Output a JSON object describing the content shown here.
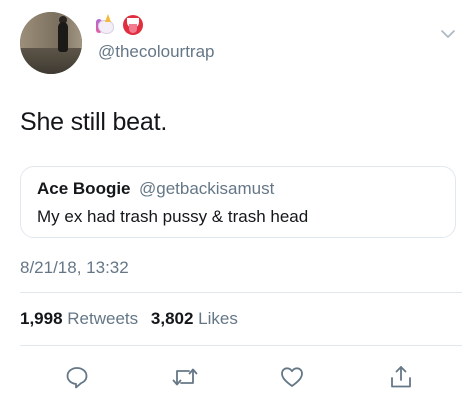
{
  "author": {
    "handle": "@thecolourtrap",
    "emoji_icons": [
      "unicorn-icon",
      "tongue-emoji-icon"
    ]
  },
  "tweet": {
    "text": "She still beat.",
    "timestamp": "8/21/18, 13:32"
  },
  "quoted_tweet": {
    "name": "Ace Boogie",
    "handle": "@getbackisamust",
    "text": "My ex had trash pussy & trash head"
  },
  "stats": {
    "retweets_count": "1,998",
    "retweets_label": "Retweets",
    "likes_count": "3,802",
    "likes_label": "Likes"
  },
  "actions": [
    "reply-icon",
    "retweet-icon",
    "like-icon",
    "share-icon"
  ],
  "colors": {
    "text": "#14171a",
    "secondary": "#657786",
    "border": "#e1e8ed",
    "icon": "#657786"
  }
}
